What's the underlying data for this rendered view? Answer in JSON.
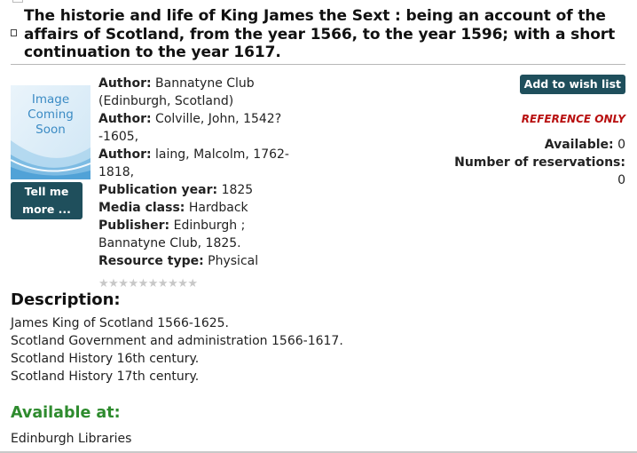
{
  "record": {
    "title": "The historie and life of King James the Sext : being an account of the affairs of Scotland, from the year 1566, to the year 1596; with a short continuation to the year 1617."
  },
  "cover": {
    "text_line1": "Image",
    "text_line2": "Coming",
    "text_line3": "Soon"
  },
  "buttons": {
    "tell_me_line1": "Tell me",
    "tell_me_line2": "more ...",
    "wish_list": "Add to wish list"
  },
  "details": {
    "author_label": "Author:",
    "author1": "Bannatyne Club (Edinburgh, Scotland)",
    "author2": "Colville, John, 1542? -1605,",
    "author3": "laing, Malcolm, 1762-1818,",
    "pubyear_label": "Publication year:",
    "pubyear": "1825",
    "media_label": "Media class:",
    "media": "Hardback",
    "publisher_label": "Publisher:",
    "publisher": "Edinburgh ; Bannatyne Club, 1825.",
    "resource_label": "Resource type:",
    "resource": "Physical"
  },
  "rating": {
    "stars": "★★★★★★★★★★",
    "count": 10,
    "filled": 0
  },
  "status": {
    "reference": "REFERENCE ONLY",
    "available_label": "Available:",
    "available": "0",
    "reservations_label": "Number of reservations:",
    "reservations": "0"
  },
  "description": {
    "heading": "Description:",
    "lines": [
      "James King of Scotland 1566-1625.",
      "Scotland Government and administration 1566-1617.",
      "Scotland History 16th century.",
      "Scotland History 17th century."
    ]
  },
  "availability": {
    "heading": "Available at:",
    "branch": "Edinburgh Libraries"
  },
  "colors": {
    "button_bg": "#1f4f5c",
    "reference": "#b80f0f",
    "available_heading": "#2e8b2e",
    "cover_text": "#3b8bc4"
  }
}
